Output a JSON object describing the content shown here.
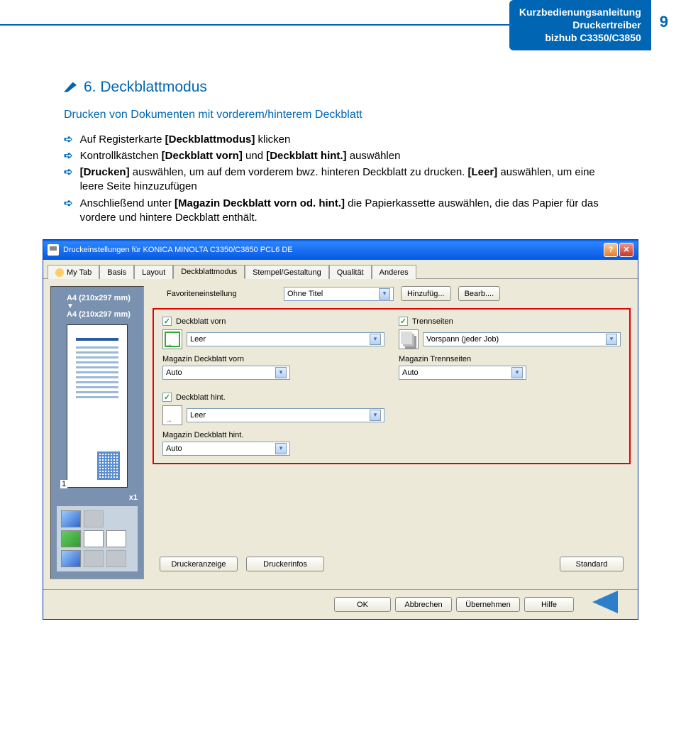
{
  "header": {
    "line1": "Kurzbedienungsanleitung",
    "line2": "Druckertreiber",
    "line3": "bizhub C3350/C3850",
    "page": "9"
  },
  "section": {
    "title": "6. Deckblattmodus",
    "subtitle": "Drucken von Dokumenten mit vorderem/hinterem Deckblatt"
  },
  "bullets": [
    {
      "pre": "Auf Registerkarte ",
      "bold": "[Deckblattmodus]",
      "post": " klicken"
    },
    {
      "pre": "Kontrollkästchen ",
      "bold": "[Deckblatt vorn]",
      "mid": " und ",
      "bold2": "[Deckblatt hint.]",
      "post": " auswählen"
    },
    {
      "bold": "[Drucken]",
      "mid": " auswählen, um auf dem vorderem bwz. hinteren Deckblatt zu drucken. ",
      "bold2": "[Leer]",
      "post": " auswählen, um eine leere Seite hinzuzufügen"
    },
    {
      "pre": "Anschließend unter ",
      "bold": "[Magazin Deckblatt vorn od.  hint.]",
      "post": " die Papierkassette auswählen, die das Papier für das vordere und hintere Deckblatt enthält."
    }
  ],
  "dialog": {
    "title": "Druckeinstellungen für KONICA MINOLTA C3350/C3850 PCL6 DE",
    "help": "?",
    "close": "✕",
    "tabs": [
      "My Tab",
      "Basis",
      "Layout",
      "Deckblattmodus",
      "Stempel/Gestaltung",
      "Qualität",
      "Anderes"
    ],
    "activeTab": 3,
    "preview": {
      "size1": "A4 (210x297 mm)",
      "size2": "A4 (210x297 mm)",
      "pageNum": "1",
      "zoom": "x1"
    },
    "fav": {
      "label": "Favoriteneinstellung",
      "value": "Ohne Titel",
      "add": "Hinzufüg...",
      "edit": "Bearb...."
    },
    "left": {
      "chk1": "Deckblatt vorn",
      "opt1": "Leer",
      "lbl1": "Magazin Deckblatt vorn",
      "val1": "Auto",
      "chk2": "Deckblatt hint.",
      "opt2": "Leer",
      "lbl2": "Magazin Deckblatt hint.",
      "val2": "Auto"
    },
    "right": {
      "chk1": "Trennseiten",
      "opt1": "Vorspann (jeder Job)",
      "lbl1": "Magazin Trennseiten",
      "val1": "Auto"
    },
    "buttons": {
      "anzeige": "Druckeranzeige",
      "infos": "Druckerinfos",
      "standard": "Standard",
      "ok": "OK",
      "cancel": "Abbrechen",
      "apply": "Übernehmen",
      "help": "Hilfe"
    }
  }
}
